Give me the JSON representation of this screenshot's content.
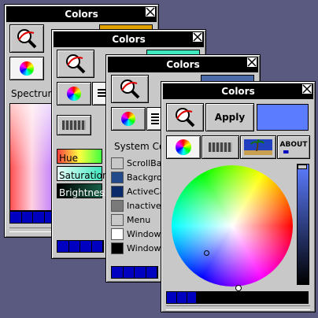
{
  "title": "Colors",
  "apply_label": "Apply",
  "about_label": "ABOUT",
  "w1": {
    "mode_label": "Spectrum"
  },
  "w2": {
    "sliders": [
      {
        "label": "Hue"
      },
      {
        "label": "Saturation"
      },
      {
        "label": "Brightness"
      }
    ]
  },
  "w3": {
    "section_label": "System Co",
    "items": [
      {
        "label": "ScrollBa",
        "color": "#c8c8c8"
      },
      {
        "label": "Backgro",
        "color": "#234a8a"
      },
      {
        "label": "ActiveCa",
        "color": "#0a2a6a"
      },
      {
        "label": "Inactive",
        "color": "#7a7a7a"
      },
      {
        "label": "Menu",
        "color": "#c8c8c8"
      },
      {
        "label": "Window",
        "color": "#ffffff"
      },
      {
        "label": "Window",
        "color": "#000000"
      }
    ]
  },
  "colors": {
    "desktop": "#5a5a80",
    "w1_swatch": "#e0a000",
    "w2_swatch": "#40e8c0",
    "w3_swatch": "#4a6aa8",
    "w4_swatch": "#5c7cff"
  }
}
